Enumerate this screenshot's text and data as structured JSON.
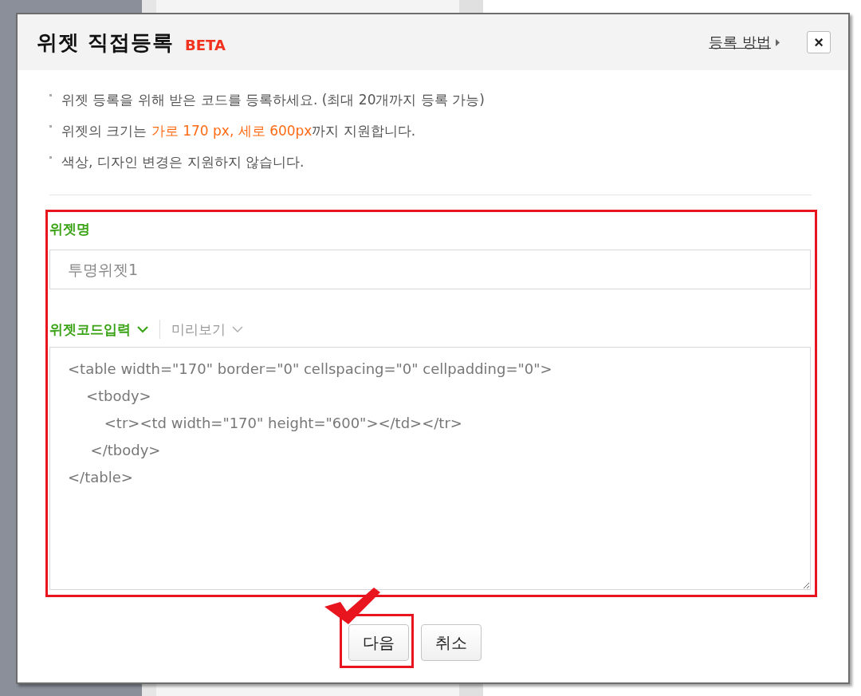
{
  "dialog": {
    "title": "위젯 직접등록",
    "badge": "BETA",
    "help_link": "등록 방법",
    "close": "×"
  },
  "notes": [
    [
      {
        "kind": "plain",
        "text": "위젯 등록을 위해 받은 코드를 등록하세요. (최대 20개까지 등록 가능)"
      }
    ],
    [
      {
        "kind": "plain",
        "text": "위젯의 크기는 "
      },
      {
        "kind": "accent",
        "text": "가로 170 px, 세로 600px"
      },
      {
        "kind": "plain",
        "text": "까지 지원합니다."
      }
    ],
    [
      {
        "kind": "plain",
        "text": "색상, 디자인 변경은 지원하지 않습니다."
      }
    ]
  ],
  "name_field": {
    "label": "위젯명",
    "placeholder": "투명위젯1"
  },
  "tabs": [
    {
      "label": "위젯코드입력",
      "selected": true
    },
    {
      "label": "미리보기",
      "selected": false
    }
  ],
  "code": "<table width=\"170\" border=\"0\" cellspacing=\"0\" cellpadding=\"0\">\n    <tbody>\n        <tr><td width=\"170\" height=\"600\"></td></tr>\n     </tbody>\n</table>",
  "buttons": [
    {
      "label": "다음",
      "selected": true
    },
    {
      "label": "취소",
      "selected": false
    }
  ]
}
